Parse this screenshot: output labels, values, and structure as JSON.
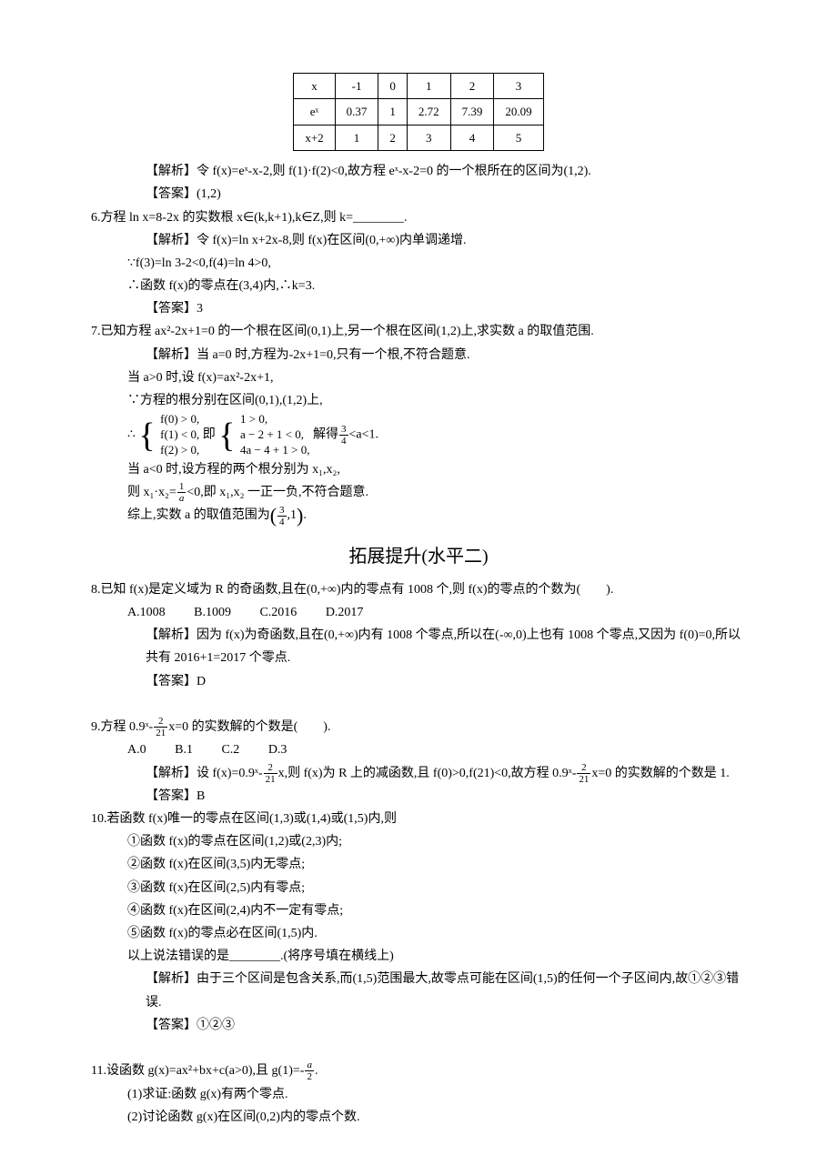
{
  "table": {
    "rows": [
      [
        "x",
        "-1",
        "0",
        "1",
        "2",
        "3"
      ],
      [
        "eˣ",
        "0.37",
        "1",
        "2.72",
        "7.39",
        "20.09"
      ],
      [
        "x+2",
        "1",
        "2",
        "3",
        "4",
        "5"
      ]
    ]
  },
  "p1_analysis": "【解析】令 f(x)=eˣ-x-2,则 f(1)·f(2)<0,故方程 eˣ-x-2=0 的一个根所在的区间为(1,2).",
  "p1_answer": "【答案】(1,2)",
  "q6": "6.方程 ln x=8-2x 的实数根 x∈(k,k+1),k∈Z,则 k=________.",
  "q6_a1": "【解析】令 f(x)=ln x+2x-8,则 f(x)在区间(0,+∞)内单调递增.",
  "q6_a2": "∵f(3)=ln 3-2<0,f(4)=ln 4>0,",
  "q6_a3": "∴函数 f(x)的零点在(3,4)内,∴k=3.",
  "q6_ans": "【答案】3",
  "q7": "7.已知方程 ax²-2x+1=0 的一个根在区间(0,1)上,另一个根在区间(1,2)上,求实数 a 的取值范围.",
  "q7_a1": "【解析】当 a=0 时,方程为-2x+1=0,只有一个根,不符合题意.",
  "q7_a2": "当 a>0 时,设 f(x)=ax²-2x+1,",
  "q7_a3": "∵方程的根分别在区间(0,1),(1,2)上,",
  "q7_brace_pre": "∴",
  "q7_b1a": "f(0) > 0,",
  "q7_b1b": "1 > 0,",
  "q7_b2a": "f(1) < 0,",
  "q7_mid": "即",
  "q7_b2b": "a − 2 + 1 < 0,",
  "q7_b3a": "f(2) > 0,",
  "q7_b3b": "4a − 4 + 1 > 0,",
  "q7_brace_tail_a": "解得",
  "q7_brace_tail_b": "<a<1.",
  "q7_a5": "当 a<0 时,设方程的两个根分别为 x₁,x₂,",
  "q7_a6a": "则 x₁·x₂=",
  "q7_a6b": "<0,即 x₁,x₂ 一正一负,不符合题意.",
  "q7_a7a": "综上,实数 a 的取值范围为",
  "q7_a7b": ".",
  "heading2": "拓展提升(水平二)",
  "q8": "8.已知 f(x)是定义域为 R 的奇函数,且在(0,+∞)内的零点有 1008 个,则 f(x)的零点的个数为(　　).",
  "q8_optA": "A.1008",
  "q8_optB": "B.1009",
  "q8_optC": "C.2016",
  "q8_optD": "D.2017",
  "q8_ana": "【解析】因为 f(x)为奇函数,且在(0,+∞)内有 1008 个零点,所以在(-∞,0)上也有 1008 个零点,又因为 f(0)=0,所以共有 2016+1=2017 个零点.",
  "q8_ans": "【答案】D",
  "q9a": "9.方程 0.9ˣ-",
  "q9b": "x=0 的实数解的个数是(　　).",
  "q9_optA": "A.0",
  "q9_optB": "B.1",
  "q9_optC": "C.2",
  "q9_optD": "D.3",
  "q9_ana_a": "【解析】设 f(x)=0.9ˣ-",
  "q9_ana_b": "x,则 f(x)为 R 上的减函数,且 f(0)>0,f(21)<0,故方程 0.9ˣ-",
  "q9_ana_c": "x=0 的实数解的个数是 1.",
  "q9_ans": "【答案】B",
  "q10": "10.若函数 f(x)唯一的零点在区间(1,3)或(1,4)或(1,5)内,则",
  "q10_1": "①函数 f(x)的零点在区间(1,2)或(2,3)内;",
  "q10_2": "②函数 f(x)在区间(3,5)内无零点;",
  "q10_3": "③函数 f(x)在区间(2,5)内有零点;",
  "q10_4": "④函数 f(x)在区间(2,4)内不一定有零点;",
  "q10_5": "⑤函数 f(x)的零点必在区间(1,5)内.",
  "q10_6": "以上说法错误的是________.(将序号填在横线上)",
  "q10_ana": "【解析】由于三个区间是包含关系,而(1,5)范围最大,故零点可能在区间(1,5)的任何一个子区间内,故①②③错误.",
  "q10_ans": "【答案】①②③",
  "q11a": "11.设函数 g(x)=ax²+bx+c(a>0),且 g(1)=-",
  "q11b": ".",
  "q11_1": "(1)求证:函数 g(x)有两个零点.",
  "q11_2": "(2)讨论函数 g(x)在区间(0,2)内的零点个数.",
  "frac_3_4_n": "3",
  "frac_3_4_d": "4",
  "frac_1_a_n": "1",
  "frac_1_a_d": "a",
  "frac_2_21_n": "2",
  "frac_2_21_d": "21",
  "frac_a_2_n": "a",
  "frac_a_2_d": "2",
  "comma": ",",
  "one": "1"
}
